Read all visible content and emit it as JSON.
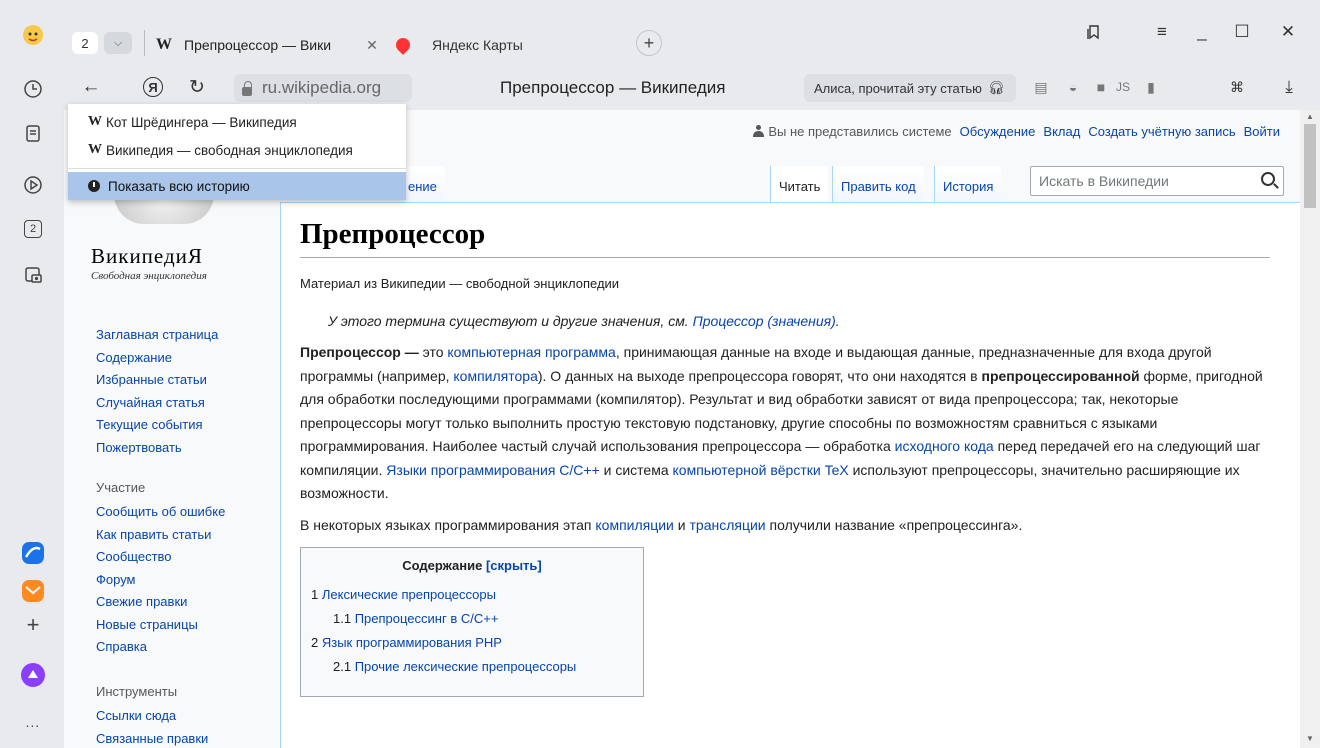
{
  "browser": {
    "tab_count": "2",
    "tabs": [
      {
        "title": "Препроцессор — Вики",
        "favicon": "W"
      },
      {
        "title": "Яндекс Карты"
      }
    ],
    "url": "ru.wikipedia.org",
    "page_title": "Препроцессор — Википедия",
    "alisa_label": "Алиса, прочитай эту статью",
    "rail_tab_count": "2"
  },
  "history_menu": {
    "items": [
      {
        "favicon": "W",
        "label": "Кот Шрёдингера — Википедия"
      },
      {
        "favicon": "W",
        "label": "Википедия — свободная энциклопедия"
      }
    ],
    "show_all": "Показать всю историю"
  },
  "wiki": {
    "userbar": {
      "not_logged": "Вы не представились системе",
      "links": [
        "Обсуждение",
        "Вклад",
        "Создать учётную запись",
        "Войти"
      ]
    },
    "tab_partial": "ение",
    "tabs": [
      "Читать",
      "Править код",
      "История"
    ],
    "search_placeholder": "Искать в Википедии",
    "logo_title": "ВикипедиЯ",
    "logo_subtitle": "Свободная энциклопедия",
    "nav_main": [
      "Заглавная страница",
      "Содержание",
      "Избранные статьи",
      "Случайная статья",
      "Текущие события",
      "Пожертвовать"
    ],
    "nav_participation_header": "Участие",
    "nav_participation": [
      "Сообщить об ошибке",
      "Как править статьи",
      "Сообщество",
      "Форум",
      "Свежие правки",
      "Новые страницы",
      "Справка"
    ],
    "nav_tools_header": "Инструменты",
    "nav_tools": [
      "Ссылки сюда",
      "Связанные правки"
    ]
  },
  "article": {
    "title": "Препроцессор",
    "from": "Материал из Википедии — свободной энциклопедии",
    "hatnote_text": "У этого термина существуют и другие значения, см.",
    "hatnote_link": "Процессор (значения)",
    "p1": {
      "bold1": "Препроцессор —",
      "t1": " это ",
      "l1": "компьютерная программа",
      "t2": ", принимающая данные на входе и выдающая данные, предназначенные для входа другой программы (например, ",
      "l2": "компилятора",
      "t3": "). О данных на выходе препроцессора говорят, что они находятся в ",
      "bold2": "препроцессированной",
      "t4": " форме, пригодной для обработки последующими программами (компилятор). Результат и вид обработки зависят от вида препроцессора; так, некоторые препроцессоры могут только выполнить простую текстовую подстановку, другие способны по возможностям сравниться с языками программирования. Наиболее частый случай использования препроцессора — обработка ",
      "l3": "исходного кода",
      "t5": " перед передачей его на следующий шаг компиляции. ",
      "l4": "Языки программирования C/C++",
      "t6": " и система ",
      "l5": "компьютерной вёрстки TeX",
      "t7": " используют препроцессоры, значительно расширяющие их возможности."
    },
    "p2": {
      "t1": "В некоторых языках программирования этап ",
      "l1": "компиляции",
      "t2": " и ",
      "l2": "трансляции",
      "t3": " получили название «препроцессинга»."
    },
    "toc": {
      "title": "Содержание",
      "toggle": "[скрыть]",
      "rows": [
        {
          "num": "1",
          "text": "Лексические препроцессоры"
        },
        {
          "num": "1.1",
          "text": "Препроцессинг в C/C++"
        },
        {
          "num": "2",
          "text": "Язык программирования PHP"
        },
        {
          "num": "2.1",
          "text": "Прочие лексические препроцессоры"
        }
      ]
    }
  }
}
